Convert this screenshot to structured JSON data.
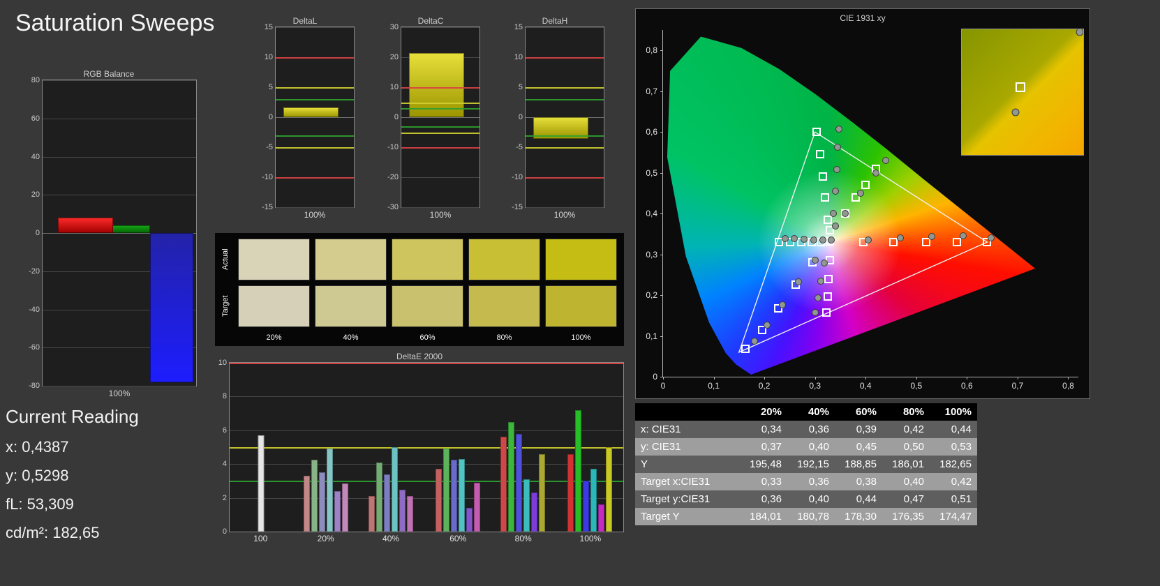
{
  "page": {
    "title": "Saturation Sweeps"
  },
  "rgb_balance": {
    "title": "RGB Balance",
    "x_label": "100%",
    "type": "bar",
    "ylim": [
      -80,
      80
    ],
    "yticks": [
      80,
      60,
      40,
      20,
      0,
      -20,
      -40,
      -60,
      -80
    ],
    "bars": [
      {
        "name": "red",
        "value": 8,
        "color_top": "#ff2a2a",
        "color_bottom": "#a00000"
      },
      {
        "name": "green",
        "value": 4,
        "color_top": "#16a816",
        "color_bottom": "#056505"
      },
      {
        "name": "blue",
        "value": -78,
        "color_top": "#2323a8",
        "color_bottom": "#1d1dff"
      }
    ]
  },
  "delta_charts": [
    {
      "title": "DeltaL",
      "x_label": "100%",
      "type": "bar",
      "ylim": [
        -15,
        15
      ],
      "yticks": [
        15,
        10,
        5,
        0,
        -5,
        -10,
        -15
      ],
      "value": 1.6,
      "ref_lines": [
        {
          "value": 10,
          "color": "#d84040"
        },
        {
          "value": 5,
          "color": "#cfcf30"
        },
        {
          "value": 3,
          "color": "#2f9f2f"
        },
        {
          "value": -3,
          "color": "#2f9f2f"
        },
        {
          "value": -5,
          "color": "#cfcf30"
        },
        {
          "value": -10,
          "color": "#d84040"
        }
      ]
    },
    {
      "title": "DeltaC",
      "x_label": "100%",
      "type": "bar",
      "ylim": [
        -30,
        30
      ],
      "yticks": [
        30,
        20,
        10,
        0,
        -10,
        -20,
        -30
      ],
      "value": 21.5,
      "ref_lines": [
        {
          "value": 10,
          "color": "#d84040"
        },
        {
          "value": 5,
          "color": "#cfcf30"
        },
        {
          "value": 3,
          "color": "#2f9f2f"
        },
        {
          "value": -3,
          "color": "#2f9f2f"
        },
        {
          "value": -5,
          "color": "#cfcf30"
        },
        {
          "value": -10,
          "color": "#d84040"
        }
      ]
    },
    {
      "title": "DeltaH",
      "x_label": "100%",
      "type": "bar",
      "ylim": [
        -15,
        15
      ],
      "yticks": [
        15,
        10,
        5,
        0,
        -5,
        -10,
        -15
      ],
      "value": -3.6,
      "ref_lines": [
        {
          "value": 10,
          "color": "#d84040"
        },
        {
          "value": 5,
          "color": "#cfcf30"
        },
        {
          "value": 3,
          "color": "#2f9f2f"
        },
        {
          "value": -3,
          "color": "#2f9f2f"
        },
        {
          "value": -5,
          "color": "#cfcf30"
        },
        {
          "value": -10,
          "color": "#d84040"
        }
      ]
    }
  ],
  "swatches": {
    "row_labels": [
      "Actual",
      "Target"
    ],
    "col_labels": [
      "20%",
      "40%",
      "60%",
      "80%",
      "100%"
    ],
    "actual_colors": [
      "#d9d3b8",
      "#d3cc8e",
      "#cec55f",
      "#c9bf35",
      "#c5bd14"
    ],
    "target_colors": [
      "#d5d0b7",
      "#cec893",
      "#c9c16e",
      "#c4ba4d",
      "#bfb42f"
    ]
  },
  "deltae_chart": {
    "title": "DeltaE 2000",
    "type": "bar",
    "ylim": [
      0,
      10
    ],
    "yticks": [
      0,
      2,
      4,
      6,
      8,
      10
    ],
    "ref_lines": [
      {
        "value": 10,
        "color": "#e04545"
      },
      {
        "value": 5,
        "color": "#cfcf30"
      },
      {
        "value": 3,
        "color": "#2f9f2f"
      }
    ],
    "groups": [
      {
        "label": "100",
        "bars": [
          {
            "value": 5.7,
            "color": "#e6e6e6"
          }
        ]
      },
      {
        "label": "20%",
        "bars": [
          {
            "value": 3.3,
            "color": "#c38787"
          },
          {
            "value": 4.25,
            "color": "#87b387"
          },
          {
            "value": 3.5,
            "color": "#8d8dbd"
          },
          {
            "value": 4.9,
            "color": "#84c6c6"
          },
          {
            "value": 2.4,
            "color": "#9d82c6"
          },
          {
            "value": 2.85,
            "color": "#c387b9"
          }
        ]
      },
      {
        "label": "40%",
        "bars": [
          {
            "value": 2.1,
            "color": "#c07575"
          },
          {
            "value": 4.1,
            "color": "#74ac74"
          },
          {
            "value": 3.4,
            "color": "#7d7dc2"
          },
          {
            "value": 5.0,
            "color": "#6cc3c3"
          },
          {
            "value": 2.5,
            "color": "#8f6cc3"
          },
          {
            "value": 2.1,
            "color": "#c072b2"
          }
        ]
      },
      {
        "label": "60%",
        "bars": [
          {
            "value": 3.7,
            "color": "#c66060"
          },
          {
            "value": 4.9,
            "color": "#5cb35c"
          },
          {
            "value": 4.25,
            "color": "#6a6acb"
          },
          {
            "value": 4.3,
            "color": "#52c2c2"
          },
          {
            "value": 1.4,
            "color": "#8455cb"
          },
          {
            "value": 2.9,
            "color": "#c65cb0"
          }
        ]
      },
      {
        "label": "80%",
        "bars": [
          {
            "value": 5.6,
            "color": "#cd4848"
          },
          {
            "value": 6.5,
            "color": "#3cb63c"
          },
          {
            "value": 5.8,
            "color": "#5050da"
          },
          {
            "value": 3.1,
            "color": "#3cbdbd"
          },
          {
            "value": 2.3,
            "color": "#7c3cda"
          },
          {
            "value": 4.6,
            "color": "#aaa832"
          }
        ]
      },
      {
        "label": "100%",
        "bars": [
          {
            "value": 4.6,
            "color": "#d23232"
          },
          {
            "value": 7.2,
            "color": "#26bd26"
          },
          {
            "value": 3.0,
            "color": "#3a3ae6"
          },
          {
            "value": 3.7,
            "color": "#2bb7b7"
          },
          {
            "value": 1.6,
            "color": "#c32bc3"
          },
          {
            "value": 5.0,
            "color": "#c9c926"
          }
        ]
      }
    ]
  },
  "cie_chart": {
    "title": "CIE 1931 xy",
    "type": "scatter",
    "tick_labels": [
      "0",
      "0,1",
      "0,2",
      "0,3",
      "0,4",
      "0,5",
      "0,6",
      "0,7",
      "0,8"
    ],
    "gamut_triangle": [
      [
        0.64,
        0.33
      ],
      [
        0.3,
        0.6
      ],
      [
        0.15,
        0.06
      ]
    ],
    "targets": [
      [
        0.329,
        0.331
      ],
      [
        0.395,
        0.33
      ],
      [
        0.455,
        0.33
      ],
      [
        0.52,
        0.33
      ],
      [
        0.58,
        0.33
      ],
      [
        0.64,
        0.33
      ],
      [
        0.325,
        0.385
      ],
      [
        0.32,
        0.44
      ],
      [
        0.315,
        0.49
      ],
      [
        0.31,
        0.545
      ],
      [
        0.303,
        0.6
      ],
      [
        0.295,
        0.28
      ],
      [
        0.262,
        0.225
      ],
      [
        0.228,
        0.168
      ],
      [
        0.196,
        0.115
      ],
      [
        0.163,
        0.068
      ],
      [
        0.312,
        0.33
      ],
      [
        0.293,
        0.33
      ],
      [
        0.273,
        0.33
      ],
      [
        0.251,
        0.33
      ],
      [
        0.229,
        0.33
      ],
      [
        0.329,
        0.285
      ],
      [
        0.327,
        0.24
      ],
      [
        0.325,
        0.197
      ],
      [
        0.323,
        0.157
      ],
      [
        0.33,
        0.36
      ],
      [
        0.36,
        0.4
      ],
      [
        0.38,
        0.44
      ],
      [
        0.4,
        0.47
      ],
      [
        0.42,
        0.51
      ]
    ],
    "measurements": [
      [
        0.332,
        0.335
      ],
      [
        0.405,
        0.336
      ],
      [
        0.468,
        0.34
      ],
      [
        0.53,
        0.344
      ],
      [
        0.592,
        0.345
      ],
      [
        0.648,
        0.34
      ],
      [
        0.336,
        0.4
      ],
      [
        0.34,
        0.455
      ],
      [
        0.343,
        0.508
      ],
      [
        0.345,
        0.563
      ],
      [
        0.347,
        0.607
      ],
      [
        0.3,
        0.286
      ],
      [
        0.268,
        0.232
      ],
      [
        0.236,
        0.176
      ],
      [
        0.206,
        0.126
      ],
      [
        0.18,
        0.088
      ],
      [
        0.316,
        0.335
      ],
      [
        0.298,
        0.336
      ],
      [
        0.279,
        0.337
      ],
      [
        0.259,
        0.338
      ],
      [
        0.241,
        0.339
      ],
      [
        0.318,
        0.279
      ],
      [
        0.312,
        0.234
      ],
      [
        0.306,
        0.193
      ],
      [
        0.3,
        0.158
      ],
      [
        0.34,
        0.37
      ],
      [
        0.36,
        0.4
      ],
      [
        0.39,
        0.45
      ],
      [
        0.42,
        0.5
      ],
      [
        0.44,
        0.53
      ]
    ],
    "inset": {
      "square": [
        48,
        46
      ],
      "circle": [
        44,
        66
      ],
      "corner_circle": [
        97,
        2
      ]
    }
  },
  "current_reading": {
    "title": "Current Reading",
    "lines": [
      {
        "label": "x:",
        "value": "0,4387"
      },
      {
        "label": "y:",
        "value": "0,5298"
      },
      {
        "label": "fL:",
        "value": "53,309"
      },
      {
        "label": "cd/m²:",
        "value": "182,65"
      }
    ]
  },
  "table": {
    "columns": [
      "20%",
      "40%",
      "60%",
      "80%",
      "100%"
    ],
    "rows": [
      {
        "label": "x: CIE31",
        "values": [
          "0,34",
          "0,36",
          "0,39",
          "0,42",
          "0,44"
        ]
      },
      {
        "label": "y: CIE31",
        "values": [
          "0,37",
          "0,40",
          "0,45",
          "0,50",
          "0,53"
        ]
      },
      {
        "label": "Y",
        "values": [
          "195,48",
          "192,15",
          "188,85",
          "186,01",
          "182,65"
        ]
      },
      {
        "label": "Target x:CIE31",
        "values": [
          "0,33",
          "0,36",
          "0,38",
          "0,40",
          "0,42"
        ]
      },
      {
        "label": "Target y:CIE31",
        "values": [
          "0,36",
          "0,40",
          "0,44",
          "0,47",
          "0,51"
        ]
      },
      {
        "label": "Target Y",
        "values": [
          "184,01",
          "180,78",
          "178,30",
          "176,35",
          "174,47"
        ]
      }
    ]
  }
}
